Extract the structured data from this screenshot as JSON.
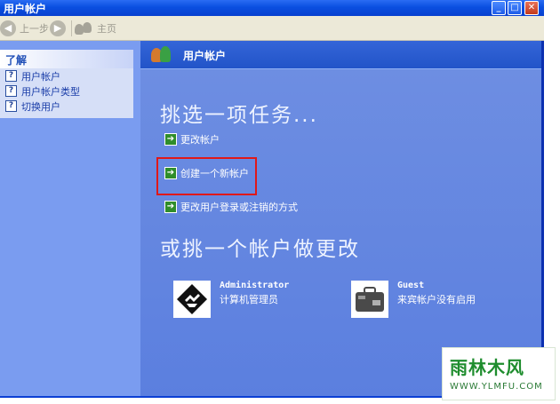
{
  "window": {
    "title": "用户帐户",
    "controls": {
      "minimize": "_",
      "maximize": "□",
      "close": "✕"
    }
  },
  "toolbar": {
    "back_label": "上一步",
    "home_label": "主页",
    "back_icon": "back-arrow-icon",
    "forward_icon": "forward-arrow-icon",
    "home_icon": "users-home-icon"
  },
  "sidebar": {
    "heading": "了解",
    "items": [
      {
        "label": "用户帐户",
        "icon": "help-icon"
      },
      {
        "label": "用户帐户类型",
        "icon": "help-icon"
      },
      {
        "label": "切换用户",
        "icon": "help-icon"
      }
    ]
  },
  "main": {
    "header_title": "用户帐户",
    "pick_task_heading": "挑选一项任务...",
    "tasks": [
      {
        "label": "更改帐户"
      },
      {
        "label": "创建一个新帐户",
        "highlighted": true
      },
      {
        "label": "更改用户登录或注销的方式"
      }
    ],
    "pick_account_heading": "或挑一个帐户做更改",
    "accounts": [
      {
        "name": "Administrator",
        "description": "计算机管理员",
        "icon": "account-picture-icon"
      },
      {
        "name": "Guest",
        "description": "来宾帐户没有启用",
        "icon": "briefcase-picture-icon"
      }
    ]
  },
  "watermark": {
    "logo_text": "雨林木风",
    "url_text": "WWW.YLMFU.COM"
  },
  "colors": {
    "titlebar": "#0a4fe0",
    "main_bg": "#5b7fdf",
    "left_bg": "#7a9cf0",
    "highlight_border": "#e01818",
    "arrow_green": "#2f8d2a"
  }
}
